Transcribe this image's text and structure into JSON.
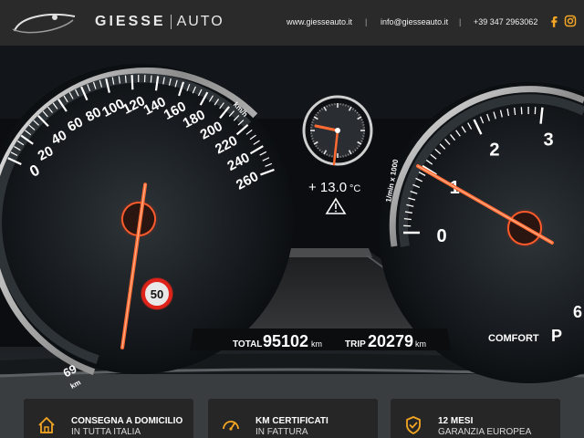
{
  "header": {
    "brand_left": "GIESSE",
    "brand_right": "AUTO",
    "website": "www.giesseauto.it",
    "email": "info@giesseauto.it",
    "phone": "+39 347 2963062",
    "separator": "|",
    "social": [
      "facebook-icon",
      "instagram-icon"
    ],
    "accent_color": "#f5a623"
  },
  "speedometer": {
    "ticks": [
      "0",
      "20",
      "40",
      "60",
      "80",
      "100",
      "120",
      "140",
      "160",
      "180",
      "200",
      "220",
      "240",
      "260"
    ],
    "unit": "km/h",
    "partial_left": "69",
    "partial_left_unit": "km"
  },
  "tachometer": {
    "ticks": [
      "0",
      "1",
      "2",
      "3"
    ],
    "unit": "1/min x 1000",
    "partial_right": "6"
  },
  "center": {
    "temperature": "+ 13.0",
    "temperature_unit": "°C",
    "warning_icon": "warning-triangle-icon",
    "speed_limit": "50"
  },
  "odometer": {
    "total_label": "TOTAL",
    "total_value": "95102",
    "total_unit": "km",
    "trip_label": "TRIP",
    "trip_value": "20279",
    "trip_unit": "km",
    "mode": "COMFORT",
    "gear": "P"
  },
  "features": [
    {
      "icon": "home-icon",
      "title": "CONSEGNA A DOMICILIO",
      "subtitle": "IN TUTTA ITALIA"
    },
    {
      "icon": "gauge-icon",
      "title": "KM CERTIFICATI",
      "subtitle": "IN FATTURA"
    },
    {
      "icon": "shield-check-icon",
      "title": "12 MESI",
      "subtitle": "GARANZIA EUROPEA"
    }
  ]
}
